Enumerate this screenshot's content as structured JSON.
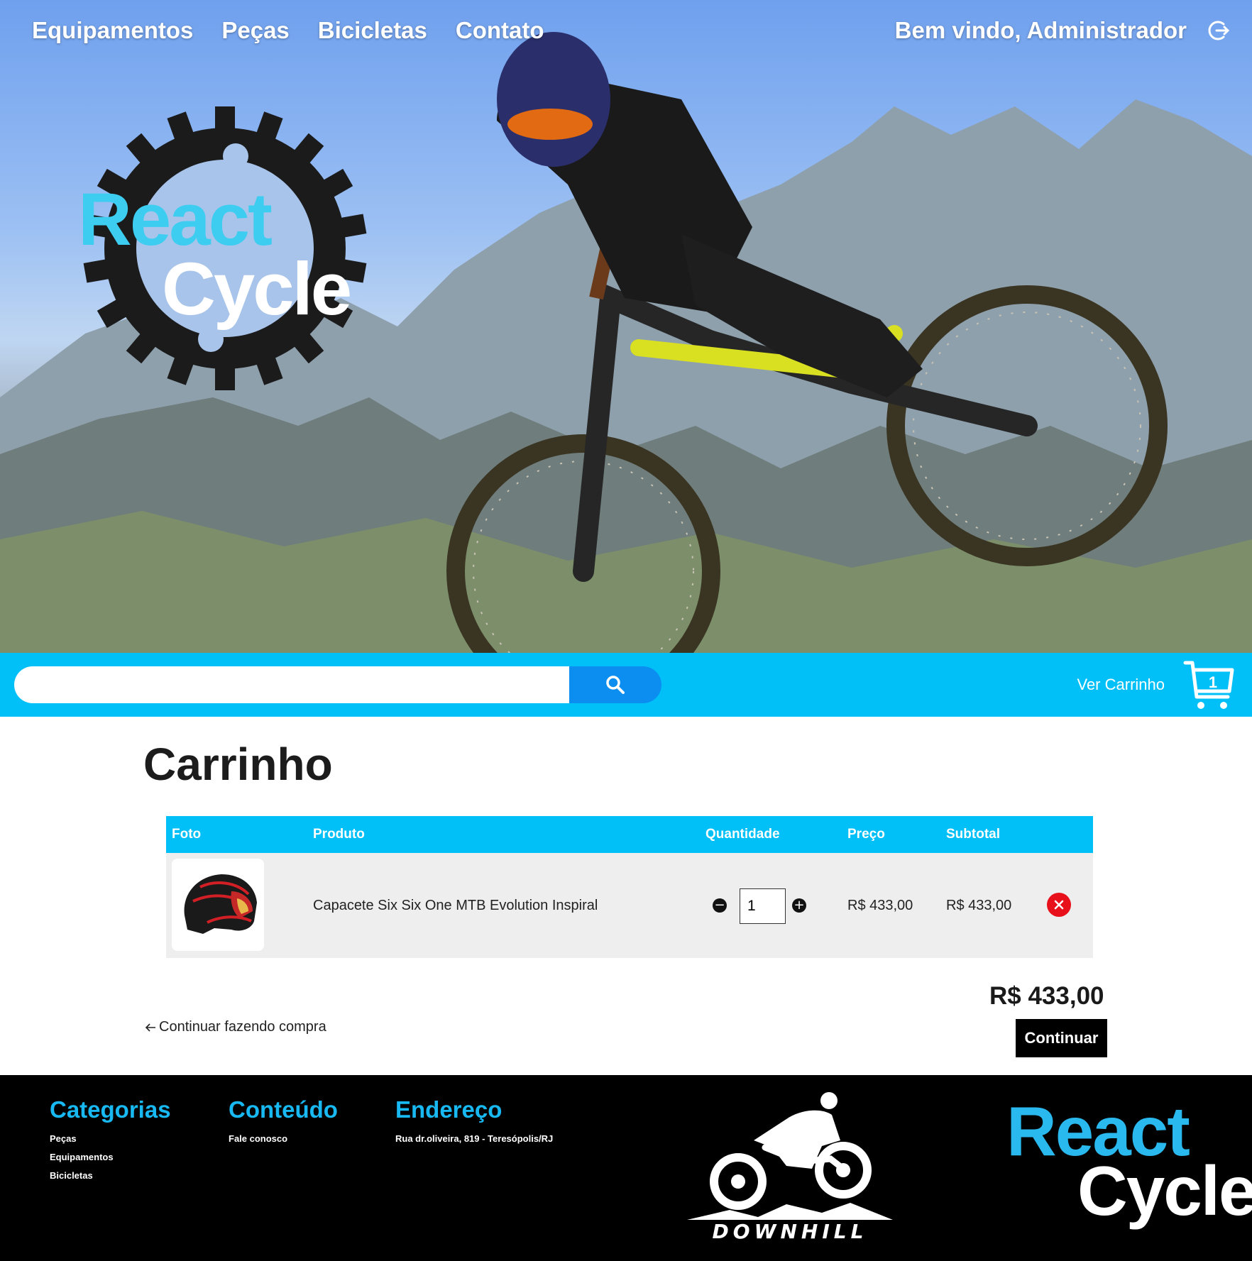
{
  "nav": {
    "items": [
      "Equipamentos",
      "Peças",
      "Bicicletas",
      "Contato"
    ],
    "welcome": "Bem vindo, Administrador",
    "logout_icon": "logout-icon"
  },
  "hero": {
    "logo_line1": "React",
    "logo_line2": "Cycle"
  },
  "search": {
    "placeholder": "",
    "button_icon": "search-icon",
    "cart_label": "Ver Carrinho",
    "cart_count": "1"
  },
  "cart": {
    "title": "Carrinho",
    "columns": [
      "Foto",
      "Produto",
      "Quantidade",
      "Preço",
      "Subtotal"
    ],
    "items": [
      {
        "product": "Capacete Six Six One MTB Evolution Inspiral",
        "quantity": "1",
        "price": "R$ 433,00",
        "subtotal": "R$ 433,00"
      }
    ],
    "total": "R$ 433,00",
    "continue_shopping": "Continuar fazendo compra",
    "continue_button": "Continuar"
  },
  "footer": {
    "categorias": {
      "title": "Categorias",
      "links": [
        "Peças",
        "Equipamentos",
        "Bicicletas"
      ]
    },
    "conteudo": {
      "title": "Conteúdo",
      "links": [
        "Fale conosco"
      ]
    },
    "endereco": {
      "title": "Endereço",
      "text": "Rua dr.oliveira, 819 - Teresópolis/RJ"
    },
    "downhill_text": "DOWNHILL",
    "logo_line1": "React",
    "logo_line2": "Cycle"
  },
  "colors": {
    "accent": "#00c0f7",
    "search_button": "#0b8ef0",
    "remove": "#e8101a",
    "footer_bg": "#000000"
  }
}
